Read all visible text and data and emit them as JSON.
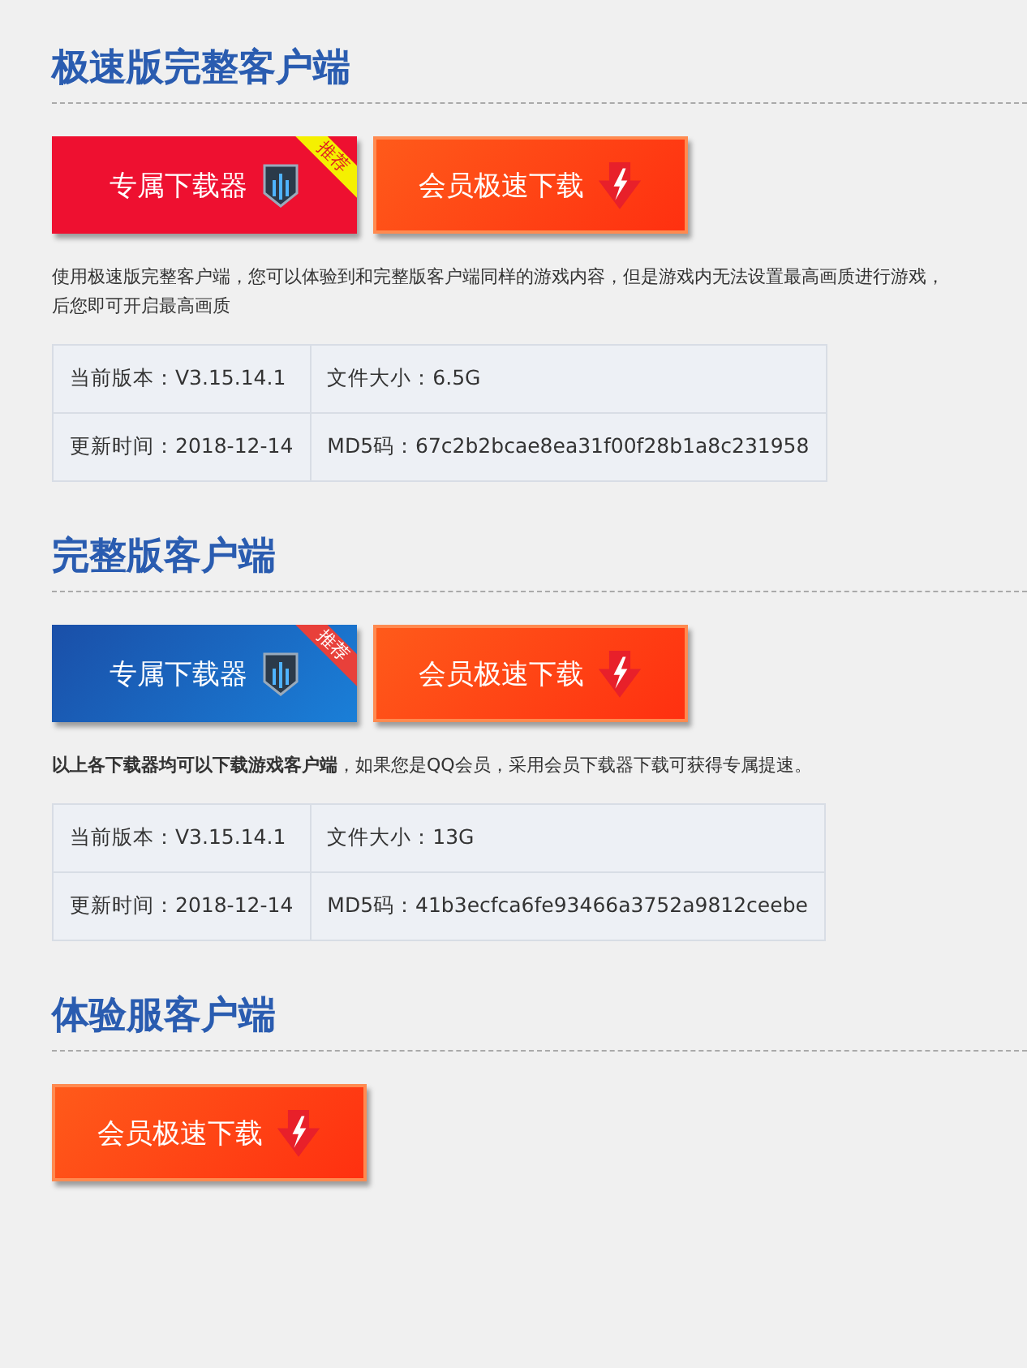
{
  "sections": [
    {
      "title": "极速版完整客户端",
      "buttons": [
        {
          "kind": "exclusive-red",
          "label": "专属下载器",
          "badge": "推荐"
        },
        {
          "kind": "vip",
          "label": "会员极速下载"
        }
      ],
      "note": {
        "lines": [
          "使用极速版完整客户端，您可以体验到和完整版客户端同样的游戏内容，但是游戏内无法设置最高画质进行游戏，",
          "后您即可开启最高画质"
        ]
      },
      "info": [
        [
          "当前版本：V3.15.14.1",
          "文件大小：6.5G"
        ],
        [
          "更新时间：2018-12-14",
          "MD5码：67c2b2bcae8ea31f00f28b1a8c231958"
        ]
      ]
    },
    {
      "title": "完整版客户端",
      "buttons": [
        {
          "kind": "exclusive-blue",
          "label": "专属下载器",
          "badge": "推荐"
        },
        {
          "kind": "vip",
          "label": "会员极速下载"
        }
      ],
      "note": {
        "lines": [
          "**以上各下载器均可以下载游戏客户端**，如果您是QQ会员，采用会员下载器下载可获得专属提速。"
        ]
      },
      "info": [
        [
          "当前版本：V3.15.14.1",
          "文件大小：13G"
        ],
        [
          "更新时间：2018-12-14",
          "MD5码：41b3ecfca6fe93466a3752a9812ceebe"
        ]
      ]
    },
    {
      "title": "体验服客户端",
      "buttons": [
        {
          "kind": "vip",
          "label": "会员极速下载"
        }
      ]
    }
  ]
}
